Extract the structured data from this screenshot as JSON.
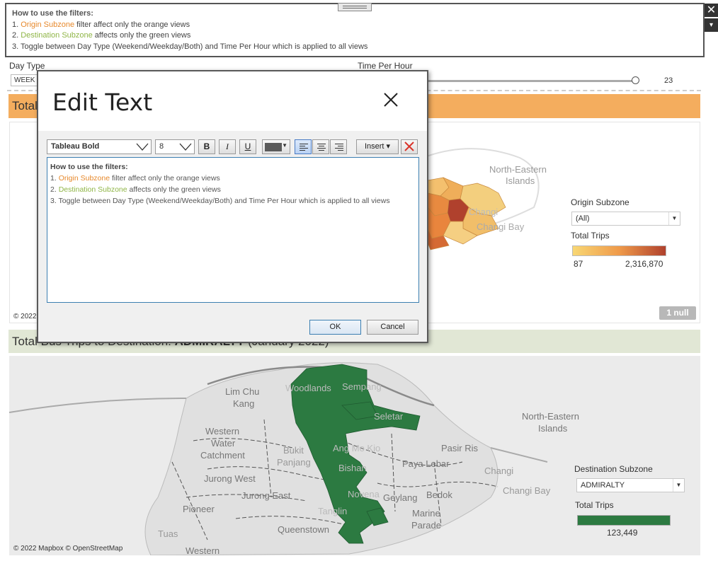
{
  "instructions": {
    "title": "How to use the filters:",
    "line1_prefix": "1. ",
    "line1_highlight": "Origin Subzone",
    "line1_rest": " filter affect only the orange views",
    "line2_prefix": "2. ",
    "line2_highlight": "Destination Subzone",
    "line2_rest": " affects only the green views",
    "line3": "3. Toggle between Day Type (Weekend/Weekday/Both) and Time Per Hour which is applied to all views"
  },
  "window_controls": {
    "close": "✕",
    "menu": "▾"
  },
  "filters": {
    "day_type_label": "Day Type",
    "day_type_value": "WEEK",
    "time_label": "Time Per Hour",
    "time_value": "23"
  },
  "origin_view": {
    "title": "Total",
    "places": [
      "North-Eastern",
      "Islands",
      "Changi",
      "Changi Bay"
    ],
    "subzone_label": "Origin Subzone",
    "subzone_value": "(All)",
    "trips_label": "Total Trips",
    "legend_min": "87",
    "legend_max": "2,316,870",
    "null_badge": "1 null",
    "copyright": "© 2022"
  },
  "dest_view": {
    "title_prefix": "Total Bus Trips to Destination: ",
    "title_bold": "ADMIRALTY",
    "title_suffix": " (January 2022)",
    "places": [
      "Lim Chu",
      "Kang",
      "Woodlands",
      "Sempang",
      "Seletar",
      "North-Eastern",
      "Islands",
      "Western",
      "Water",
      "Catchment",
      "Bukit",
      "Panjang",
      "Ang Mo Kio",
      "Bishan",
      "Pasir Ris",
      "Paya Lebar",
      "Changi",
      "Jurong West",
      "Jurong East",
      "Novena",
      "Geylang",
      "Bedok",
      "Changi Bay",
      "Pioneer",
      "Tanglin",
      "Marine",
      "Parade",
      "Queenstown",
      "Tuas",
      "Western"
    ],
    "subzone_label": "Destination Subzone",
    "subzone_value": "ADMIRALTY",
    "trips_label": "Total Trips",
    "trips_value": "123,449",
    "copyright": "© 2022 Mapbox © OpenStreetMap"
  },
  "dialog": {
    "title": "Edit Text",
    "font_value": "Tableau Bold",
    "size_value": "8",
    "bold": "B",
    "italic": "I",
    "underline": "U",
    "insert": "Insert ▾",
    "editor_title": "How to use the filters:",
    "editor_line3": "3. Toggle between Day Type (Weekend/Weekday/Both) and Time Per Hour which is applied to all views",
    "ok": "OK",
    "cancel": "Cancel"
  },
  "colors": {
    "orange_accent": "#e7892c",
    "green_accent": "#8fb546",
    "origin_bar": "#f4ad5e",
    "dest_bar": "#e1e7d5",
    "dest_fill": "#2c7a41"
  }
}
